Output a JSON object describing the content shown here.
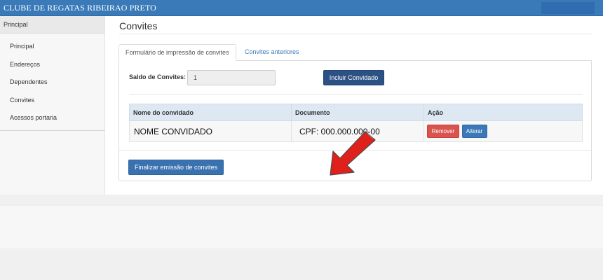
{
  "header": {
    "brand": "CLUBE DE REGATAS RIBEIRAO PRETO",
    "accent": "#3a7ab8"
  },
  "sidebar": {
    "heading": "Principal",
    "items": [
      {
        "label": "Principal"
      },
      {
        "label": "Endereços"
      },
      {
        "label": "Dependentes"
      },
      {
        "label": "Convites"
      },
      {
        "label": "Acessos portaria"
      }
    ]
  },
  "main": {
    "title": "Convites",
    "tabs": [
      {
        "label": "Formulário de impressão de convites",
        "active": true
      },
      {
        "label": "Convites anteriores",
        "active": false
      }
    ],
    "saldo": {
      "label": "Saldo de Convites:",
      "value": "1"
    },
    "incluir_label": "Incluir Convidado",
    "table": {
      "headers": [
        "Nome do convidado",
        "Documento",
        "Ação"
      ],
      "rows": [
        {
          "nome": "NOME CONVIDADO",
          "documento": "CPF: 000.000.000-00",
          "remover": "Remover",
          "alterar": "Alterar"
        }
      ]
    },
    "finalizar_label": "Finalizar emissão de convites"
  },
  "colors": {
    "danger": "#d9534f",
    "primary": "#3a72b0",
    "dark_primary": "#2c5185",
    "annotation_arrow": "#e0201b"
  }
}
